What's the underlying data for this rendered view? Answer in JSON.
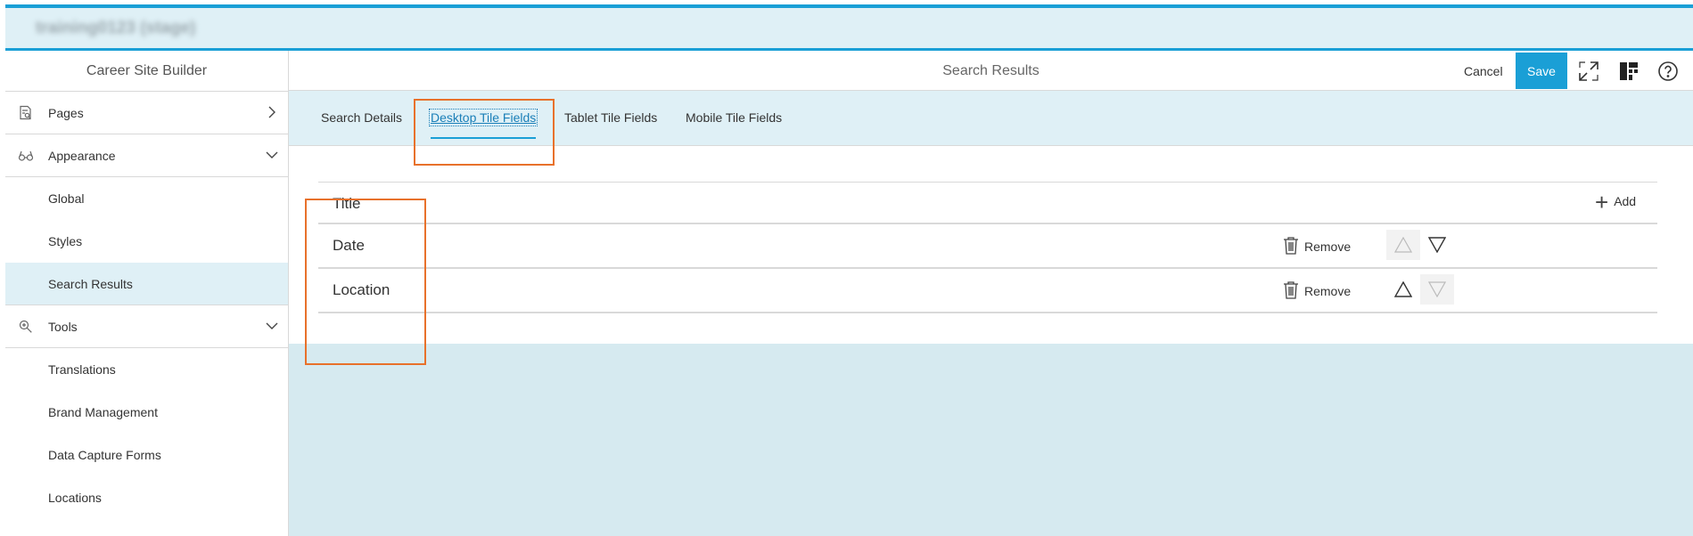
{
  "app": {
    "tenant_name": "training0123 (stage)"
  },
  "sidebar": {
    "title": "Career Site Builder",
    "items": [
      {
        "label": "Pages",
        "icon": "page-search-icon",
        "chevron": "chevron-right-icon"
      },
      {
        "label": "Appearance",
        "icon": "glasses-icon",
        "chevron": "chevron-down-icon"
      },
      {
        "label": "Global"
      },
      {
        "label": "Styles"
      },
      {
        "label": "Search Results",
        "active": true
      },
      {
        "label": "Tools",
        "icon": "tools-icon",
        "chevron": "chevron-down-icon"
      },
      {
        "label": "Translations"
      },
      {
        "label": "Brand Management"
      },
      {
        "label": "Data Capture Forms"
      },
      {
        "label": "Locations"
      }
    ]
  },
  "header": {
    "title": "Search Results",
    "cancel_label": "Cancel",
    "save_label": "Save",
    "icons": [
      "expand-icon",
      "layout-icon",
      "help-icon"
    ]
  },
  "tabs": [
    {
      "label": "Search Details"
    },
    {
      "label": "Desktop Tile Fields",
      "active": true
    },
    {
      "label": "Tablet Tile Fields"
    },
    {
      "label": "Mobile Tile Fields"
    }
  ],
  "fields": {
    "add_label": "Add",
    "remove_label": "Remove",
    "rows": [
      {
        "label": "Title"
      },
      {
        "label": "Date"
      },
      {
        "label": "Location"
      }
    ]
  },
  "colors": {
    "accent": "#1a9fd6",
    "highlight": "#e8712b",
    "panel_bg": "#dff0f6"
  }
}
